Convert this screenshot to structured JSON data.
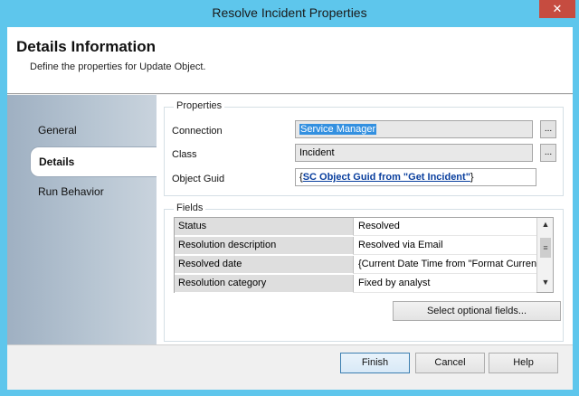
{
  "window": {
    "title": "Resolve Incident Properties",
    "close_glyph": "✕"
  },
  "header": {
    "title": "Details Information",
    "subtitle": "Define the properties for Update Object."
  },
  "nav": {
    "items": [
      {
        "label": "General",
        "selected": false
      },
      {
        "label": "Details",
        "selected": true
      },
      {
        "label": "Run Behavior",
        "selected": false
      }
    ]
  },
  "properties": {
    "legend": "Properties",
    "connection": {
      "label": "Connection",
      "value": "Service Manager",
      "browse": "..."
    },
    "class": {
      "label": "Class",
      "value": "Incident",
      "browse": "..."
    },
    "object_guid": {
      "label": "Object Guid",
      "open_brace": "{",
      "link": "SC Object Guid from \"Get Incident\"",
      "close_brace": "}"
    }
  },
  "fields": {
    "legend": "Fields",
    "rows": [
      {
        "name": "Status",
        "value": "Resolved"
      },
      {
        "name": "Resolution description",
        "value": "Resolved via Email"
      },
      {
        "name": "Resolved date",
        "value": "{Current Date Time from \"Format Curren"
      },
      {
        "name": "Resolution category",
        "value": "Fixed by analyst"
      }
    ],
    "select_optional_label": "Select optional fields..."
  },
  "footer": {
    "finish_label": "Finish",
    "cancel_label": "Cancel",
    "help_label": "Help"
  },
  "colors": {
    "titlebar": "#5ec6ec",
    "close": "#c64c40",
    "selection": "#3390e0",
    "link": "#0a3f9e"
  }
}
